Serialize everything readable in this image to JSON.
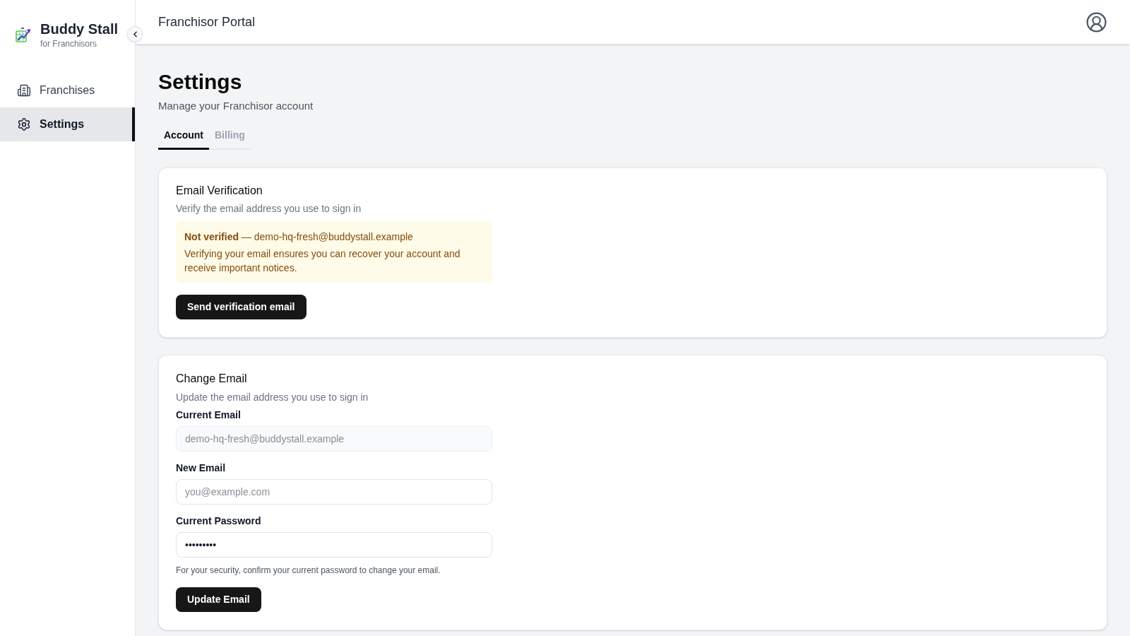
{
  "sidebar": {
    "brand": {
      "name": "Buddy Stall",
      "tagline": "for Franchisors"
    },
    "items": [
      {
        "label": "Franchises",
        "selected": false
      },
      {
        "label": "Settings",
        "selected": true
      }
    ]
  },
  "header": {
    "title": "Franchisor Portal"
  },
  "page": {
    "title": "Settings",
    "subtitle": "Manage your Franchisor account"
  },
  "tabs": [
    {
      "label": "Account",
      "selected": true
    },
    {
      "label": "Billing",
      "selected": false
    }
  ],
  "email_verification": {
    "title": "Email Verification",
    "description": "Verify the email address you use to sign in",
    "alert": {
      "status": "**Not verified** — demo-hq-fresh@buddystall.example",
      "message": "Verifying your email ensures you can recover your account and receive important notices."
    },
    "button": "Send verification email"
  },
  "change_email": {
    "title": "Change Email",
    "description": "Update the email address you use to sign in",
    "fields": [
      {
        "label": "Current Email",
        "kind": "text",
        "value": "demo-hq-fresh@buddystall.example",
        "disabled": true
      },
      {
        "label": "New Email",
        "kind": "text",
        "placeholder": "you@example.com",
        "disabled": false
      },
      {
        "label": "Current Password",
        "kind": "password",
        "value": "•••••••••",
        "disabled": false
      }
    ],
    "help": "For your security, confirm your current password to change your email.",
    "button": "Update Email"
  }
}
